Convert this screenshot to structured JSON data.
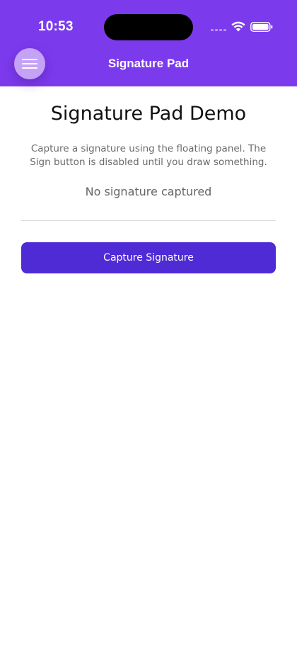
{
  "status_bar": {
    "time": "10:53",
    "icons": [
      "cellular-signal-icon",
      "wifi-icon",
      "battery-icon"
    ]
  },
  "header": {
    "title": "Signature Pad",
    "menu_icon": "hamburger-menu-icon",
    "background_color": "#7c3aed"
  },
  "main": {
    "title": "Signature Pad Demo",
    "description": "Capture a signature using the floating panel. The Sign button is disabled until you draw something.",
    "status": "No signature captured",
    "capture_button_label": "Capture Signature",
    "accent_color": "#4f2bd6"
  }
}
